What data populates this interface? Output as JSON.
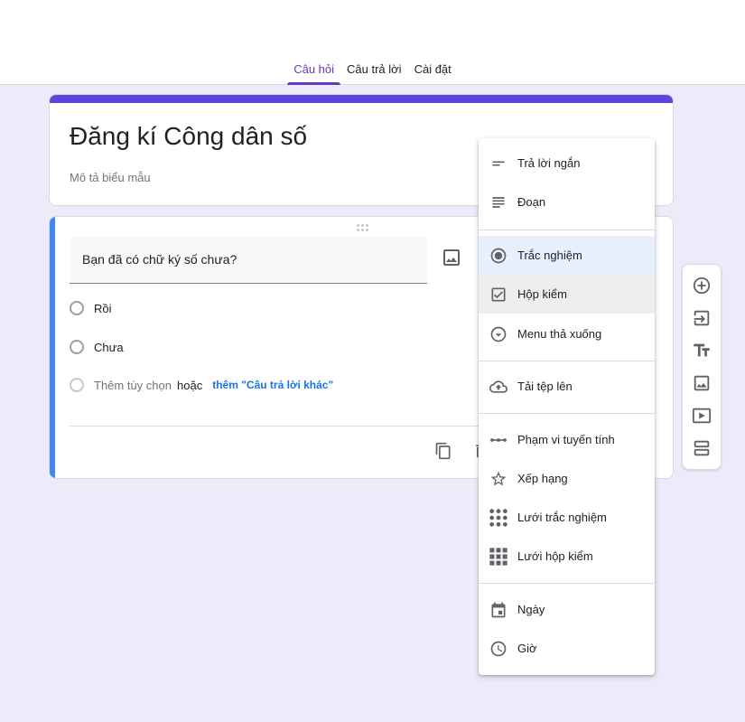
{
  "tabs": [
    {
      "label": "Câu hỏi",
      "active": true
    },
    {
      "label": "Câu trả lời",
      "active": false
    },
    {
      "label": "Cài đặt",
      "active": false
    }
  ],
  "form": {
    "title": "Đăng kí Công dân số",
    "description": "Mô tả biểu mẫu"
  },
  "question": {
    "text": "Bạn đã có chữ ký số chưa?",
    "options": [
      "Rồi",
      "Chưa"
    ],
    "add_option": "Thêm tùy chọn",
    "or_text": "hoặc",
    "add_other": "thêm \"Câu trả lời khác\""
  },
  "type_menu": {
    "items": [
      {
        "label": "Trả lời ngắn",
        "icon": "short-answer-icon"
      },
      {
        "label": "Đoạn",
        "icon": "paragraph-icon"
      },
      {
        "label": "Trắc nghiệm",
        "icon": "radio-button-icon",
        "selected": true
      },
      {
        "label": "Hộp kiểm",
        "icon": "checkbox-icon",
        "hover": true
      },
      {
        "label": "Menu thả xuống",
        "icon": "dropdown-icon"
      },
      {
        "label": "Tải tệp lên",
        "icon": "cloud-upload-icon"
      },
      {
        "label": "Phạm vi tuyến tính",
        "icon": "linear-scale-icon"
      },
      {
        "label": "Xếp hạng",
        "icon": "star-icon"
      },
      {
        "label": "Lưới trắc nghiệm",
        "icon": "radio-grid-icon"
      },
      {
        "label": "Lưới hộp kiểm",
        "icon": "checkbox-grid-icon"
      },
      {
        "label": "Ngày",
        "icon": "calendar-icon"
      },
      {
        "label": "Giờ",
        "icon": "clock-icon"
      }
    ]
  },
  "side_toolbar": [
    "add-question-icon",
    "import-questions-icon",
    "add-title-icon",
    "add-image-icon",
    "add-video-icon",
    "add-section-icon"
  ],
  "colors": {
    "accent": "#673ab7",
    "header_bar": "#5b45de",
    "question_bar": "#4285f4",
    "link": "#1a73e8",
    "background": "#ecebfa"
  }
}
